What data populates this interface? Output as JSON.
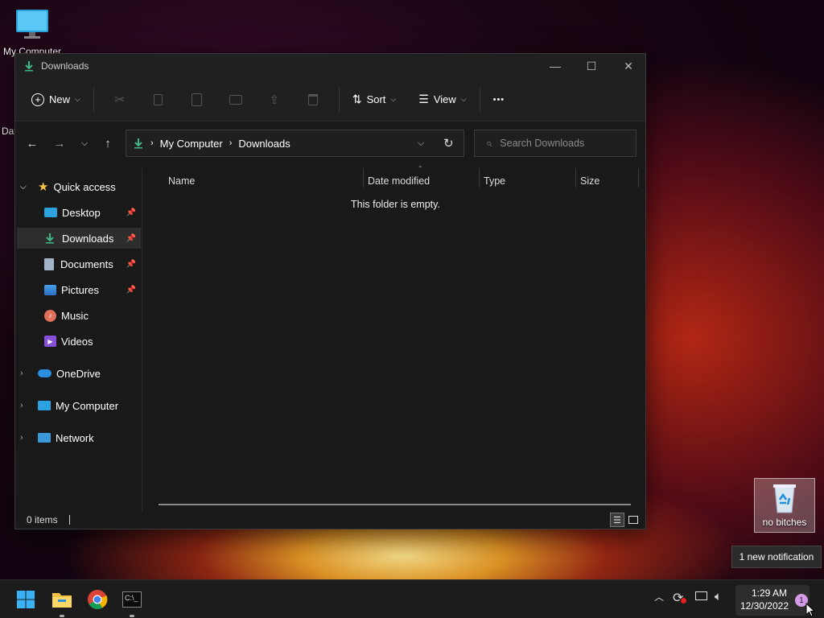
{
  "desktop": {
    "my_computer_label": "My Computer",
    "partial_label": "Dat",
    "recycle_label": "no bitches"
  },
  "window": {
    "title": "Downloads",
    "controls": {
      "minimize": "—",
      "maximize": "☐",
      "close": "✕"
    }
  },
  "toolbar": {
    "new_label": "New",
    "sort_label": "Sort",
    "view_label": "View",
    "more_label": "•••"
  },
  "address": {
    "segments": [
      "My Computer",
      "Downloads"
    ],
    "search_placeholder": "Search Downloads"
  },
  "sidebar": {
    "quick_access": "Quick access",
    "items": [
      {
        "label": "Desktop",
        "pinned": true
      },
      {
        "label": "Downloads",
        "pinned": true,
        "selected": true
      },
      {
        "label": "Documents",
        "pinned": true
      },
      {
        "label": "Pictures",
        "pinned": true
      },
      {
        "label": "Music",
        "pinned": false
      },
      {
        "label": "Videos",
        "pinned": false
      }
    ],
    "onedrive": "OneDrive",
    "my_computer": "My Computer",
    "network": "Network"
  },
  "columns": [
    "Name",
    "Date modified",
    "Type",
    "Size"
  ],
  "empty_message": "This folder is empty.",
  "status": {
    "items_count": "0 items"
  },
  "notification": {
    "text": "1 new notification",
    "badge": "1"
  },
  "clock": {
    "time": "1:29 AM",
    "date": "12/30/2022"
  },
  "colors": {
    "accent_green": "#3fb88a",
    "selection": "#2d2d2d",
    "folder_yellow": "#f4c244"
  }
}
